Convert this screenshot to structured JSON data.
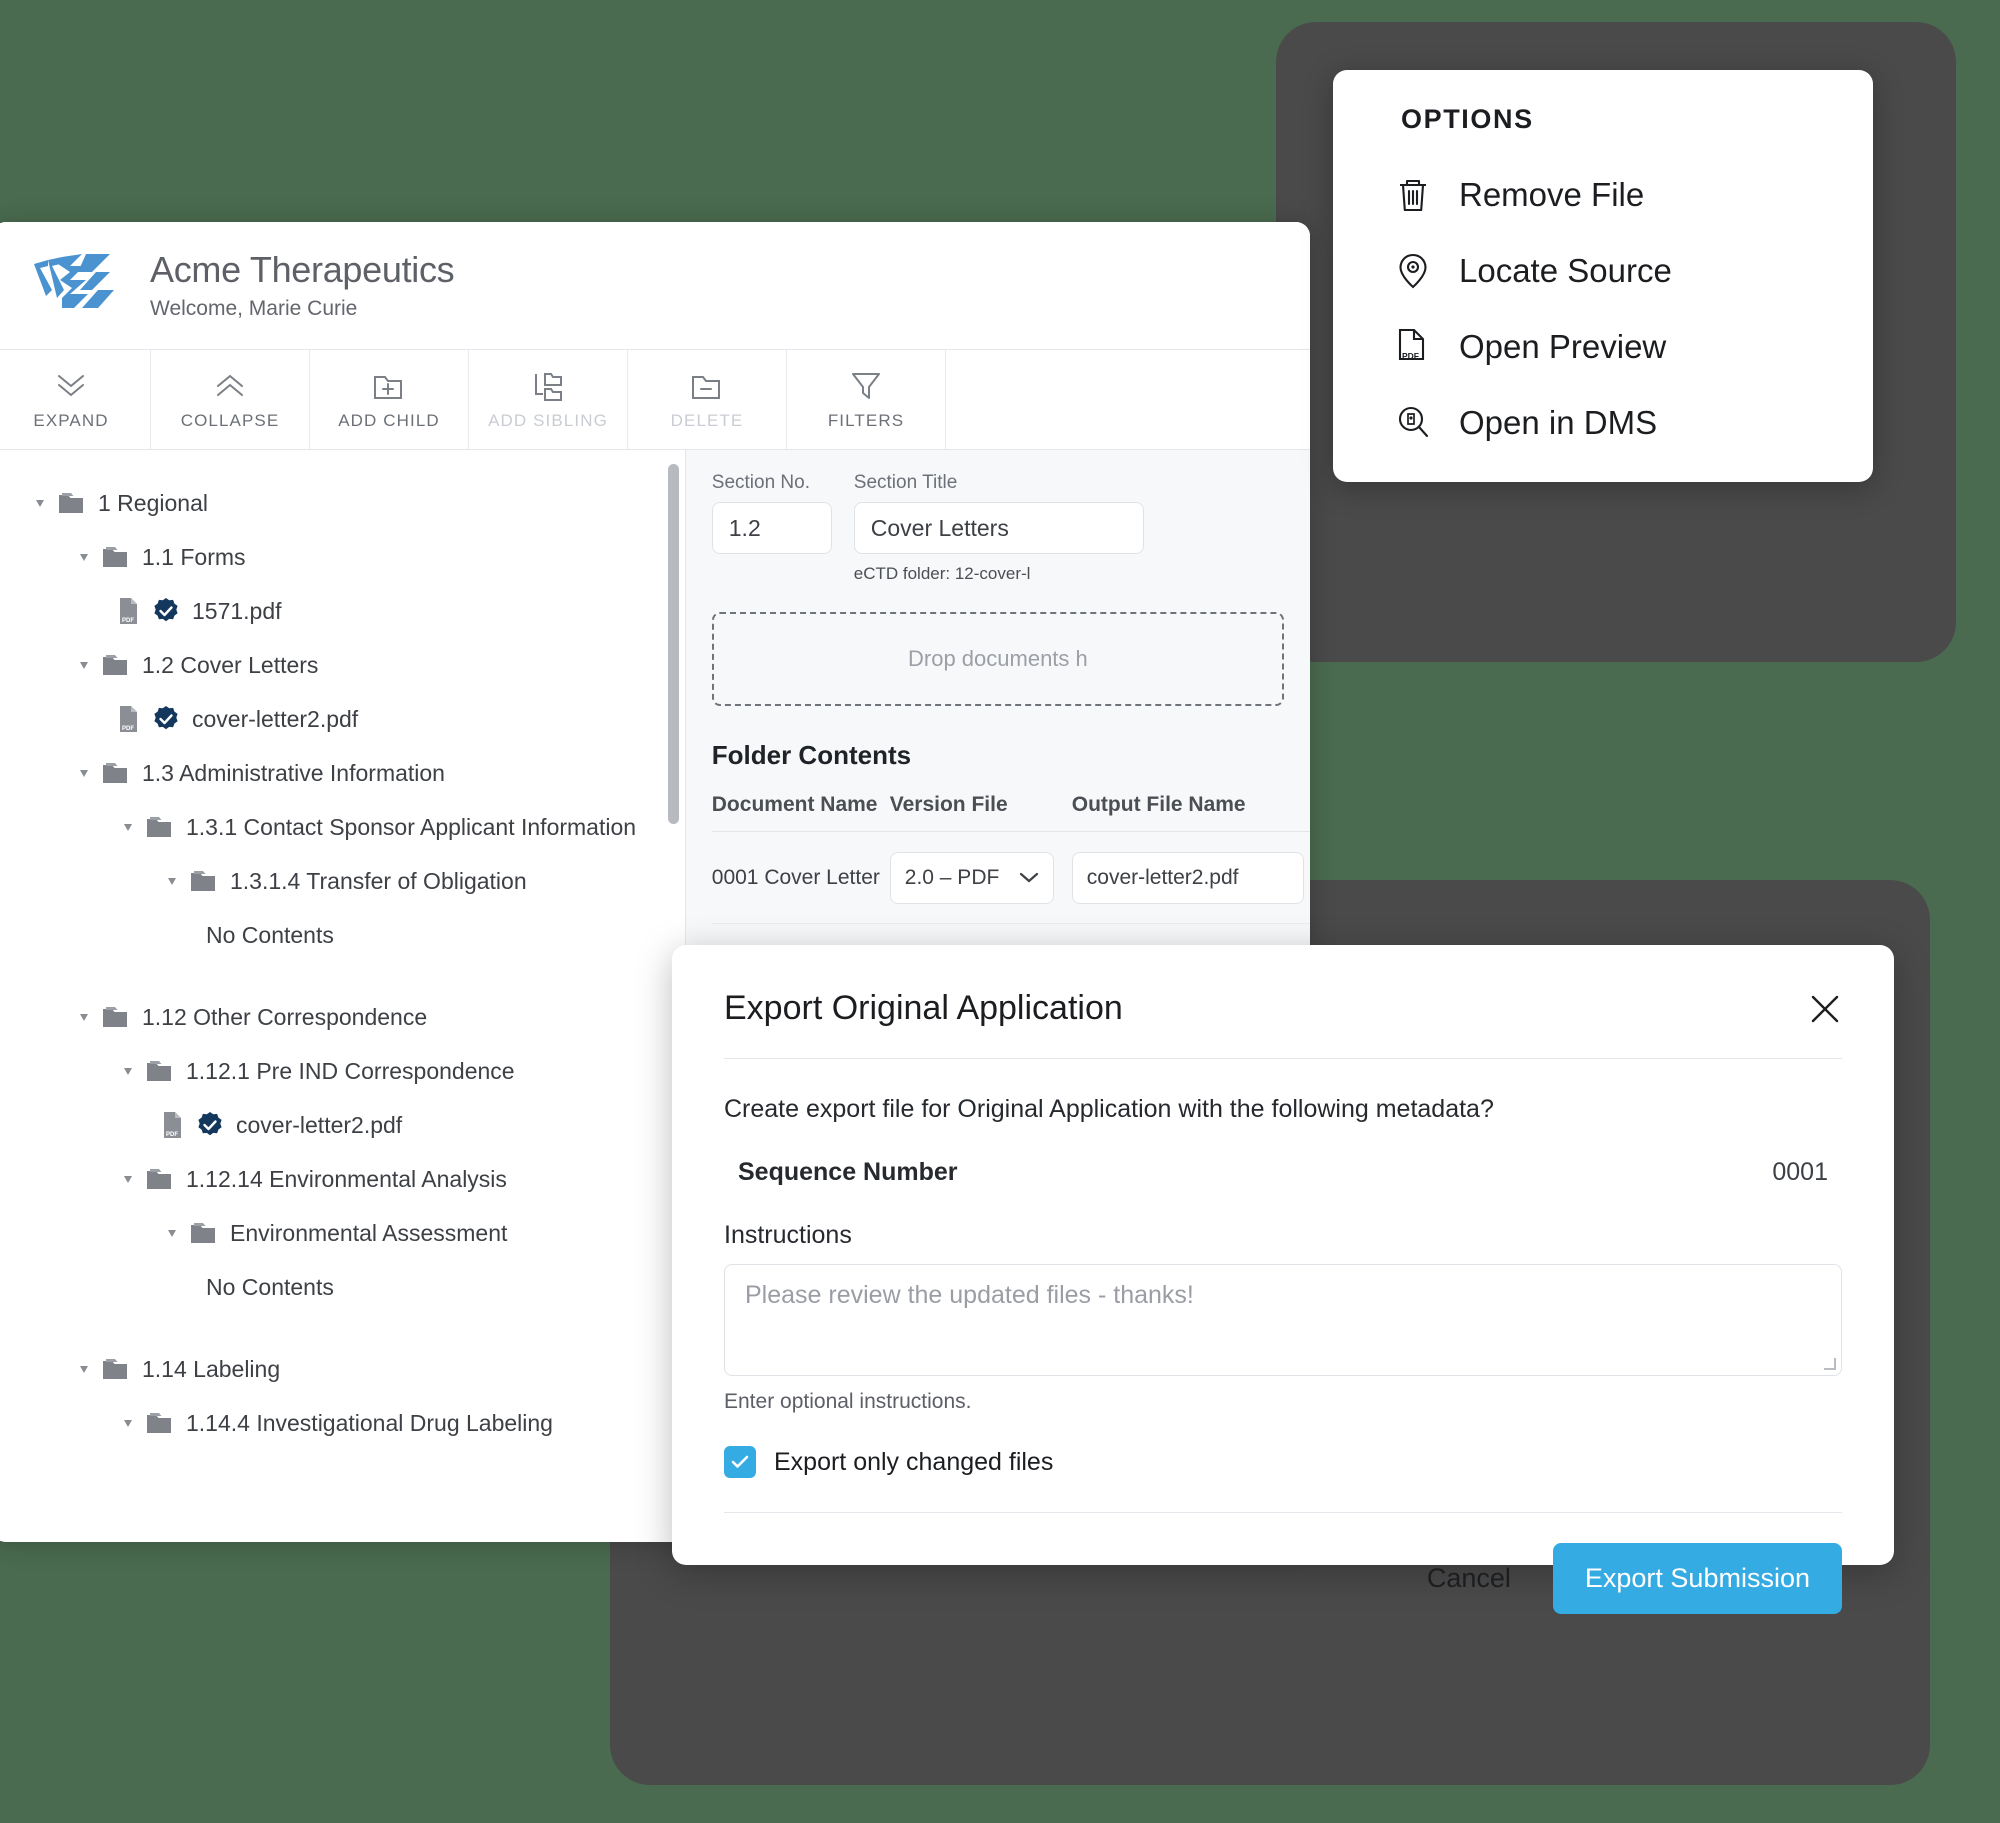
{
  "theme": {
    "page_background": "#4a6b4f",
    "panel_dark": "#4a4a4a",
    "accent": "#34abe3",
    "badge_navy": "#14375e",
    "logo_blue": "#4a93d0"
  },
  "app": {
    "header": {
      "logo_icon": "acme-chevron-logo",
      "org_title": "Acme Therapeutics",
      "welcome": "Welcome, Marie Curie"
    },
    "toolbar": [
      {
        "label": "EXPAND",
        "icon": "double-chevron-down-icon",
        "disabled": false
      },
      {
        "label": "COLLAPSE",
        "icon": "double-chevron-up-icon",
        "disabled": false
      },
      {
        "label": "ADD CHILD",
        "icon": "folder-plus-icon",
        "disabled": false
      },
      {
        "label": "ADD SIBLING",
        "icon": "folder-sibling-icon",
        "disabled": true
      },
      {
        "label": "DELETE",
        "icon": "folder-minus-icon",
        "disabled": true
      },
      {
        "label": "FILTERS",
        "icon": "funnel-icon",
        "disabled": false
      }
    ],
    "tree": [
      {
        "label": "1 Regional",
        "indent": 0,
        "type": "folder",
        "expanded": true
      },
      {
        "label": "1.1 Forms",
        "indent": 1,
        "type": "folder",
        "expanded": true
      },
      {
        "label": "1571.pdf",
        "indent": 2,
        "type": "file",
        "verified": true
      },
      {
        "label": "1.2 Cover Letters",
        "indent": 1,
        "type": "folder",
        "expanded": true
      },
      {
        "label": "cover-letter2.pdf",
        "indent": 2,
        "type": "file",
        "verified": true
      },
      {
        "label": "1.3 Administrative Information",
        "indent": 1,
        "type": "folder",
        "expanded": true
      },
      {
        "label": "1.3.1 Contact Sponsor Applicant Information",
        "indent": 2,
        "type": "folder",
        "expanded": true
      },
      {
        "label": "1.3.1.4 Transfer of Obligation",
        "indent": 3,
        "type": "folder",
        "expanded": true
      },
      {
        "label": "No Contents",
        "indent": 4,
        "type": "empty"
      },
      {
        "label": "",
        "indent": 0,
        "type": "spacer"
      },
      {
        "label": "1.12 Other Correspondence",
        "indent": 1,
        "type": "folder",
        "expanded": true
      },
      {
        "label": "1.12.1 Pre IND Correspondence",
        "indent": 2,
        "type": "folder",
        "expanded": true
      },
      {
        "label": "cover-letter2.pdf",
        "indent": 3,
        "type": "file",
        "verified": true
      },
      {
        "label": "1.12.14 Environmental Analysis",
        "indent": 2,
        "type": "folder",
        "expanded": true
      },
      {
        "label": "Environmental Assessment",
        "indent": 3,
        "type": "folder",
        "expanded": true
      },
      {
        "label": "No Contents",
        "indent": 4,
        "type": "empty"
      },
      {
        "label": "",
        "indent": 0,
        "type": "spacer"
      },
      {
        "label": "1.14 Labeling",
        "indent": 1,
        "type": "folder",
        "expanded": true
      },
      {
        "label": "1.14.4 Investigational Drug Labeling",
        "indent": 2,
        "type": "folder",
        "expanded": true
      }
    ],
    "detail": {
      "section_no_label": "Section No.",
      "section_no_value": "1.2",
      "section_title_label": "Section Title",
      "section_title_value": "Cover Letters",
      "ectd_note": "eCTD folder: 12-cover-l",
      "dropzone_text": "Drop documents h",
      "folder_contents_title": "Folder Contents",
      "columns": [
        "Document Name",
        "Version File",
        "Output File Name"
      ],
      "rows": [
        {
          "document_name": "0001 Cover Letter",
          "version_file": "2.0 – PDF",
          "output_file_name": "cover-letter2.pdf",
          "kebab_icon": "kebab-menu-icon"
        }
      ]
    }
  },
  "options_menu": {
    "title": "OPTIONS",
    "items": [
      {
        "label": "Remove File",
        "icon": "trash-icon"
      },
      {
        "label": "Locate Source",
        "icon": "map-pin-icon"
      },
      {
        "label": "Open Preview",
        "icon": "pdf-file-icon"
      },
      {
        "label": "Open in DMS",
        "icon": "search-doc-icon"
      }
    ]
  },
  "export_modal": {
    "title": "Export Original Application",
    "close_icon": "close-icon",
    "subtitle": "Create export file for Original Application with the following metadata?",
    "sequence_label": "Sequence Number",
    "sequence_value": "0001",
    "instructions_label": "Instructions",
    "instructions_placeholder": "Please review the updated files - thanks!",
    "instructions_value": "",
    "instructions_help": "Enter optional instructions.",
    "changed_only_label": "Export only changed files",
    "changed_only_checked": true,
    "cancel_label": "Cancel",
    "submit_label": "Export Submission"
  }
}
